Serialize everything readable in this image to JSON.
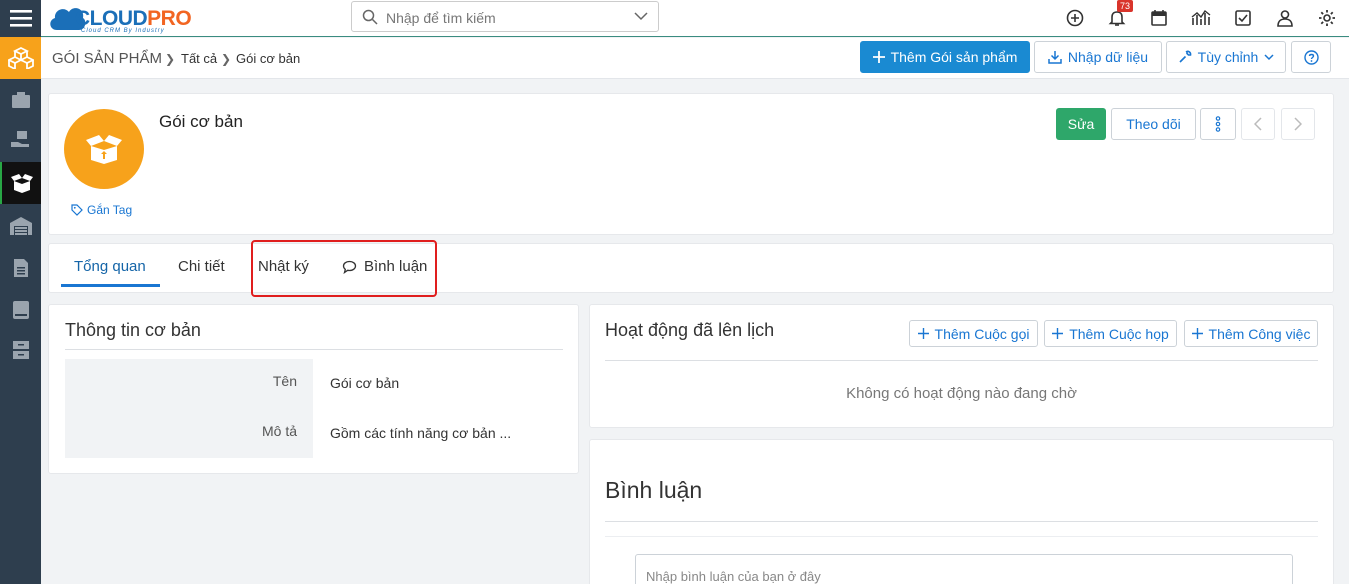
{
  "app": {
    "logo_main": "CLOUD",
    "logo_accent": "PRO",
    "logo_tagline": "Cloud CRM By Industry"
  },
  "search": {
    "placeholder": "Nhập để tìm kiếm"
  },
  "notifications": {
    "count": "73"
  },
  "breadcrumb": {
    "module": "GÓI SẢN PHẨM",
    "all": "Tất cả",
    "current": "Gói cơ bản"
  },
  "toolbar": {
    "add_label": "Thêm Gói sản phẩm",
    "import_label": "Nhập dữ liệu",
    "customize_label": "Tùy chỉnh"
  },
  "record": {
    "title": "Gói cơ bản",
    "tag_label": "Gắn Tag",
    "edit_label": "Sửa",
    "follow_label": "Theo dõi"
  },
  "tabs": [
    {
      "label": "Tổng quan"
    },
    {
      "label": "Chi tiết"
    },
    {
      "label": "Nhật ký"
    },
    {
      "label": "Bình luận"
    }
  ],
  "info_panel": {
    "title": "Thông tin cơ bản",
    "fields": [
      {
        "label": "Tên",
        "value": "Gói cơ bản"
      },
      {
        "label": "Mô tả",
        "value": "Gồm các tính năng cơ bản ..."
      }
    ]
  },
  "activity_panel": {
    "title": "Hoạt động đã lên lịch",
    "add_call": "Thêm Cuộc gọi",
    "add_meeting": "Thêm Cuộc họp",
    "add_task": "Thêm Công việc",
    "empty_text": "Không có hoạt động nào đang chờ"
  },
  "comment_panel": {
    "title": "Bình luận",
    "placeholder": "Nhập bình luận của bạn ở đây"
  },
  "colors": {
    "sidebar": "#2e3e4e",
    "accent_orange": "#f7a21b",
    "primary_blue": "#1a8ad2",
    "edit_green": "#2ea76a",
    "highlight_red": "#e01e1e"
  }
}
